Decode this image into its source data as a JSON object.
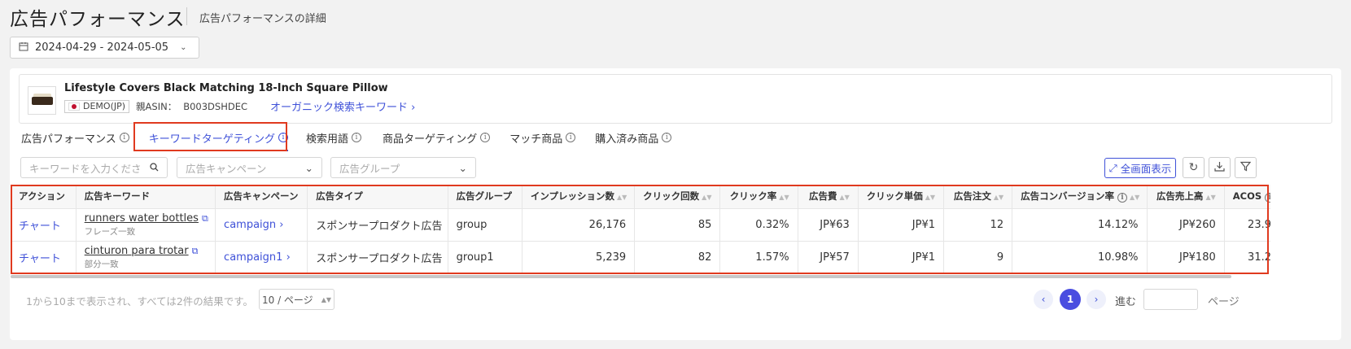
{
  "header": {
    "title": "広告パフォーマンス",
    "subtitle": "広告パフォーマンスの詳細",
    "date_range": "2024-04-29 - 2024-05-05"
  },
  "product": {
    "name": "Lifestyle Covers Black Matching 18-Inch Square Pillow",
    "marketplace": "DEMO(JP)",
    "parent_asin_label": "親ASIN：",
    "parent_asin": "B003DSHDEC",
    "organic_link": "オーガニック検索キーワード"
  },
  "tabs": [
    {
      "label": "広告パフォーマンス",
      "active": false
    },
    {
      "label": "キーワードターゲティング",
      "active": true
    },
    {
      "label": "検索用語",
      "active": false
    },
    {
      "label": "商品ターゲティング",
      "active": false
    },
    {
      "label": "マッチ商品",
      "active": false
    },
    {
      "label": "購入済み商品",
      "active": false
    }
  ],
  "filters": {
    "keyword_placeholder": "キーワードを入力くださ",
    "campaign_placeholder": "広告キャンペーン",
    "adgroup_placeholder": "広告グループ",
    "fullscreen_label": "全画面表示"
  },
  "table": {
    "columns": [
      "アクション",
      "広告キーワード",
      "広告キャンペーン",
      "広告タイプ",
      "広告グループ",
      "インプレッション数",
      "クリック回数",
      "クリック率",
      "広告費",
      "クリック単価",
      "広告注文",
      "広告コンバージョン率",
      "広告売上高",
      "ACOS"
    ],
    "rows": [
      {
        "action": "チャート",
        "keyword": "runners water bottles",
        "match": "フレーズ一致",
        "campaign": "campaign",
        "ad_type": "スポンサープロダクト広告",
        "ad_group": "group",
        "impressions": "26,176",
        "clicks": "85",
        "ctr": "0.32%",
        "spend": "JP¥63",
        "cpc": "JP¥1",
        "orders": "12",
        "cvr": "14.12%",
        "sales": "JP¥260",
        "acos": "23.9"
      },
      {
        "action": "チャート",
        "keyword": "cinturon para trotar",
        "match": "部分一致",
        "campaign": "campaign1",
        "ad_type": "スポンサープロダクト広告",
        "ad_group": "group1",
        "impressions": "5,239",
        "clicks": "82",
        "ctr": "1.57%",
        "spend": "JP¥57",
        "cpc": "JP¥1",
        "orders": "9",
        "cvr": "10.98%",
        "sales": "JP¥180",
        "acos": "31.2"
      }
    ]
  },
  "pagination": {
    "summary": "1から10まで表示され、すべては2件の結果です。",
    "page_size": "10 / ページ",
    "current_page": "1",
    "goto_label": "進む",
    "page_label": "ページ"
  },
  "colors": {
    "accent": "#3f51d8",
    "highlight_box": "#e03a1f"
  }
}
